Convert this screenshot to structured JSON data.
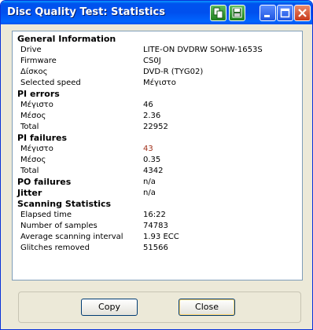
{
  "window": {
    "title": "Disc Quality Test: Statistics"
  },
  "titlebar_icons": [
    "copy-icon",
    "save-icon",
    "minimize-icon",
    "maximize-icon",
    "close-icon"
  ],
  "rows": [
    {
      "type": "section",
      "label": "General Information"
    },
    {
      "type": "item",
      "label": "Drive",
      "value": "LITE-ON DVDRW SOHW-1653S"
    },
    {
      "type": "item",
      "label": "Firmware",
      "value": "CS0J"
    },
    {
      "type": "item",
      "label": "Δίσκος",
      "value": "DVD-R (TYG02)"
    },
    {
      "type": "item",
      "label": "Selected speed",
      "value": "Μέγιστο"
    },
    {
      "type": "section",
      "label": "PI errors"
    },
    {
      "type": "item",
      "label": "Μέγιστο",
      "value": "46"
    },
    {
      "type": "item",
      "label": "Μέσος",
      "value": "2.36"
    },
    {
      "type": "item",
      "label": "Total",
      "value": "22952"
    },
    {
      "type": "section",
      "label": "PI failures"
    },
    {
      "type": "item",
      "label": "Μέγιστο",
      "value": "43",
      "highlight": "#a0301a"
    },
    {
      "type": "item",
      "label": "Μέσος",
      "value": "0.35"
    },
    {
      "type": "item",
      "label": "Total",
      "value": "4342"
    },
    {
      "type": "section",
      "label": "PO failures",
      "value": "n/a"
    },
    {
      "type": "section",
      "label": "Jitter",
      "value": "n/a"
    },
    {
      "type": "section",
      "label": "Scanning Statistics"
    },
    {
      "type": "item",
      "label": "Elapsed time",
      "value": "16:22"
    },
    {
      "type": "item",
      "label": "Number of samples",
      "value": "74783"
    },
    {
      "type": "item",
      "label": "Average scanning interval",
      "value": "1.93 ECC"
    },
    {
      "type": "item",
      "label": "Glitches removed",
      "value": "51566"
    }
  ],
  "buttons": {
    "copy": "Copy",
    "close": "Close"
  },
  "colors": {
    "titlebar": "#0053ee",
    "highlight_value": "#a0301a",
    "dialog_bg": "#ece9d8"
  }
}
